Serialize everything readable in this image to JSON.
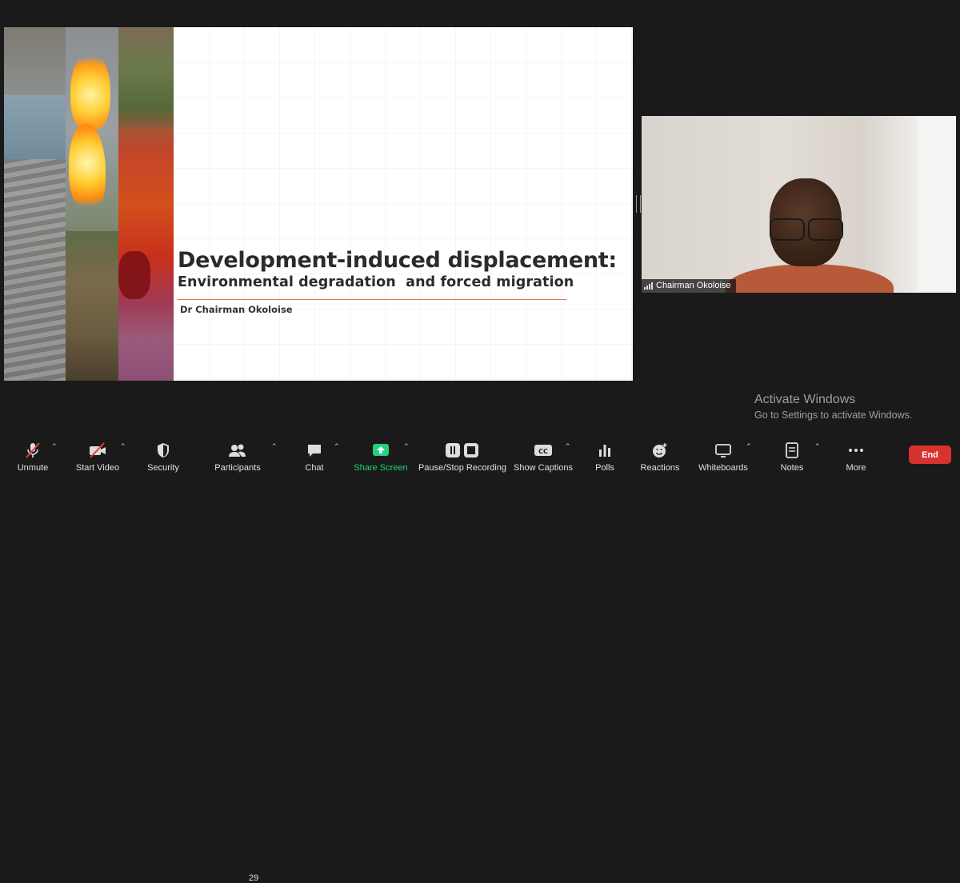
{
  "slide": {
    "title": "Development-induced displacement:",
    "subtitle": "Environmental degradation  and forced migration",
    "author": "Dr Chairman Okoloise"
  },
  "participant_video": {
    "name": "Chairman Okoloise"
  },
  "watermark": {
    "title": "Activate Windows",
    "subtitle": "Go to Settings to activate Windows."
  },
  "toolbar": {
    "unmute": "Unmute",
    "start_video": "Start Video",
    "security": "Security",
    "participants": "Participants",
    "participants_count": "29",
    "chat": "Chat",
    "share_screen": "Share Screen",
    "recording": "Pause/Stop Recording",
    "captions": "Show Captions",
    "polls": "Polls",
    "reactions": "Reactions",
    "whiteboards": "Whiteboards",
    "notes": "Notes",
    "more": "More",
    "end": "End"
  },
  "colors": {
    "share_green": "#26d07c",
    "end_red": "#d7322e",
    "accent_rule": "#e8744a",
    "background": "#1a1a1a"
  },
  "icons": [
    "microphone-muted-icon",
    "video-off-icon",
    "shield-icon",
    "participants-icon",
    "chat-bubble-icon",
    "share-arrow-icon",
    "pause-stop-icon",
    "cc-icon",
    "polls-icon",
    "reactions-icon",
    "whiteboard-icon",
    "notes-icon",
    "more-dots-icon",
    "caret-up-icon",
    "signal-bars-icon"
  ]
}
